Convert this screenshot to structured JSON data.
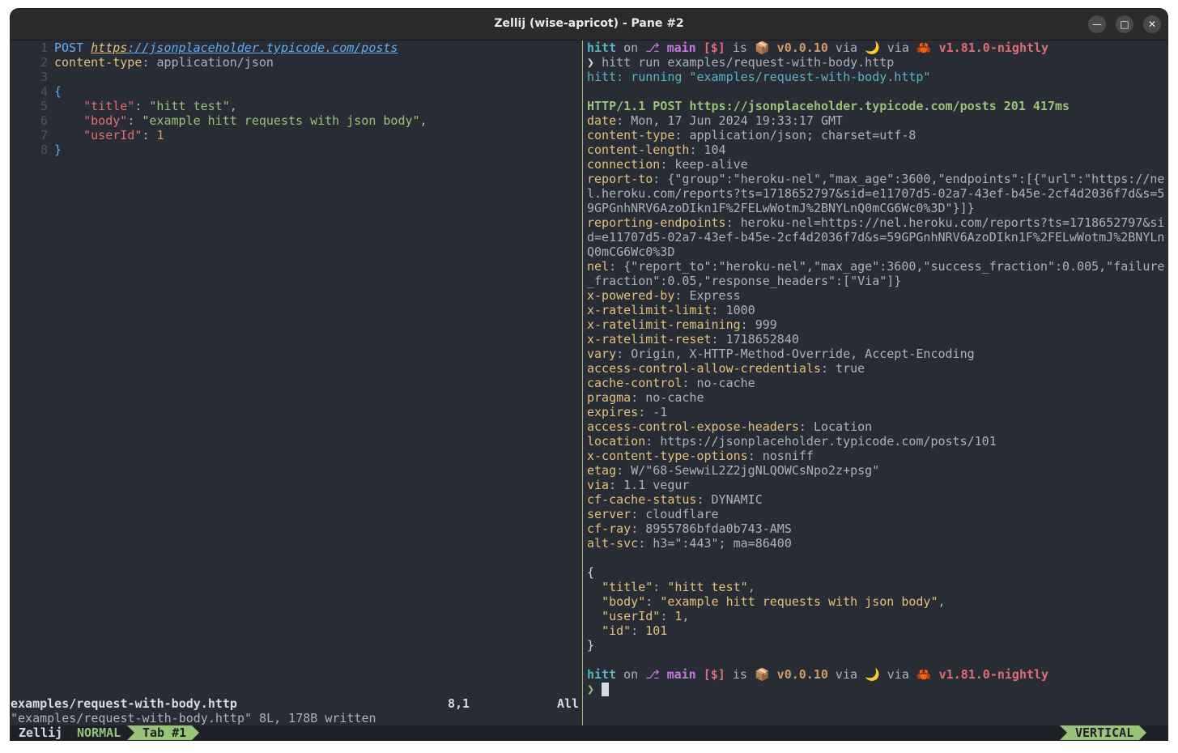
{
  "window": {
    "title": "Zellij (wise-apricot) - Pane #2",
    "minimize_icon": "minimize-icon",
    "maximize_icon": "maximize-icon",
    "close_icon": "close-icon"
  },
  "editor": {
    "line_numbers": [
      "1",
      "2",
      "3",
      "4",
      "5",
      "6",
      "7",
      "8"
    ],
    "method": "POST",
    "url_scheme": "https",
    "url_rest": "://jsonplaceholder.typicode.com/posts",
    "header_key": "content-type",
    "header_value": "application/json",
    "open_brace": "{",
    "close_brace": "}",
    "fields": [
      {
        "key": "\"title\"",
        "value": "\"hitt test\"",
        "sep": ","
      },
      {
        "key": "\"body\"",
        "value": "\"example hitt requests with json body\"",
        "sep": ","
      },
      {
        "key": "\"userId\"",
        "value": "1",
        "sep": ""
      }
    ],
    "status_file": "examples/request-with-body.http",
    "status_pos": "8,1",
    "status_all": "All",
    "message": "\"examples/request-with-body.http\" 8L, 178B written"
  },
  "terminal": {
    "prompt": {
      "dir": "hitt",
      "on": "on",
      "branch_icon": "git-branch-icon",
      "branch": "main",
      "git_status": "[$]",
      "is": "is",
      "pkg_icon": "📦",
      "version": "v0.0.10",
      "via1": "via",
      "moon": "🌙",
      "via2": "via",
      "crab": "🦀",
      "rust_version": "v1.81.0-nightly"
    },
    "chevron": "❯",
    "command": "hitt run examples/request-with-body.http",
    "running": "hitt: running \"examples/request-with-body.http\"",
    "status_line": "HTTP/1.1 POST https://jsonplaceholder.typicode.com/posts 201 417ms",
    "headers": [
      {
        "k": "date",
        "v": "Mon, 17 Jun 2024 19:33:17 GMT"
      },
      {
        "k": "content-type",
        "v": "application/json; charset=utf-8"
      },
      {
        "k": "content-length",
        "v": "104"
      },
      {
        "k": "connection",
        "v": "keep-alive"
      },
      {
        "k": "report-to",
        "v": "{\"group\":\"heroku-nel\",\"max_age\":3600,\"endpoints\":[{\"url\":\"https://ne"
      },
      {
        "k": "",
        "v": "l.heroku.com/reports?ts=1718652797&sid=e11707d5-02a7-43ef-b45e-2cf4d2036f7d&s=5"
      },
      {
        "k": "",
        "v": "9GPGnhNRV6AzoDIkn1F%2FELwWotmJ%2BNYLnQ0mCG6Wc0%3D\"}]}"
      },
      {
        "k": "reporting-endpoints",
        "v": "heroku-nel=https://nel.heroku.com/reports?ts=1718652797&si"
      },
      {
        "k": "",
        "v": "d=e11707d5-02a7-43ef-b45e-2cf4d2036f7d&s=59GPGnhNRV6AzoDIkn1F%2FELwWotmJ%2BNYLn"
      },
      {
        "k": "",
        "v": "Q0mCG6Wc0%3D"
      },
      {
        "k": "nel",
        "v": "{\"report_to\":\"heroku-nel\",\"max_age\":3600,\"success_fraction\":0.005,\"failure"
      },
      {
        "k": "",
        "v": "_fraction\":0.05,\"response_headers\":[\"Via\"]}"
      },
      {
        "k": "x-powered-by",
        "v": "Express"
      },
      {
        "k": "x-ratelimit-limit",
        "v": "1000"
      },
      {
        "k": "x-ratelimit-remaining",
        "v": "999"
      },
      {
        "k": "x-ratelimit-reset",
        "v": "1718652840"
      },
      {
        "k": "vary",
        "v": "Origin, X-HTTP-Method-Override, Accept-Encoding"
      },
      {
        "k": "access-control-allow-credentials",
        "v": "true"
      },
      {
        "k": "cache-control",
        "v": "no-cache"
      },
      {
        "k": "pragma",
        "v": "no-cache"
      },
      {
        "k": "expires",
        "v": "-1"
      },
      {
        "k": "access-control-expose-headers",
        "v": "Location"
      },
      {
        "k": "location",
        "v": "https://jsonplaceholder.typicode.com/posts/101"
      },
      {
        "k": "x-content-type-options",
        "v": "nosniff"
      },
      {
        "k": "etag",
        "v": "W/\"68-SewwiL2Z2jgNLQOWCsNpo2z+psg\""
      },
      {
        "k": "via",
        "v": "1.1 vegur"
      },
      {
        "k": "cf-cache-status",
        "v": "DYNAMIC"
      },
      {
        "k": "server",
        "v": "cloudflare"
      },
      {
        "k": "cf-ray",
        "v": "8955786bfda0b743-AMS"
      },
      {
        "k": "alt-svc",
        "v": "h3=\":443\"; ma=86400"
      }
    ],
    "body": {
      "open": "{",
      "close": "}",
      "fields": [
        {
          "k": "\"title\"",
          "v": "\"hitt test\"",
          "sep": ",",
          "type": "str"
        },
        {
          "k": "\"body\"",
          "v": "\"example hitt requests with json body\"",
          "sep": ",",
          "type": "str"
        },
        {
          "k": "\"userId\"",
          "v": "1",
          "sep": ",",
          "type": "num"
        },
        {
          "k": "\"id\"",
          "v": "101",
          "sep": "",
          "type": "num"
        }
      ]
    }
  },
  "zellij": {
    "name": "Zellij",
    "mode": "NORMAL",
    "tab": "Tab #1",
    "layout": "VERTICAL"
  }
}
